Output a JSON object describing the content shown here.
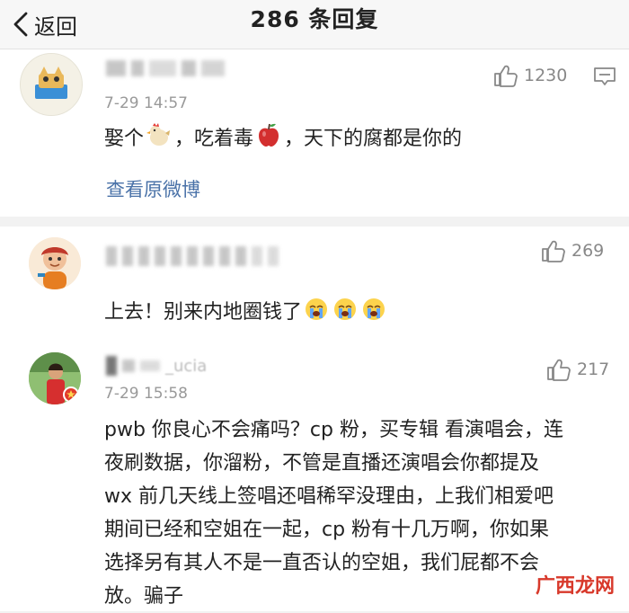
{
  "header": {
    "back_label": "返回",
    "title": "286 条回复"
  },
  "comments": [
    {
      "time": "7-29 14:57",
      "likes": "1230",
      "text_parts": [
        "娶个",
        "，吃着毒",
        "，天下的腐都是你的"
      ],
      "link": "查看原微博"
    },
    {
      "likes": "269",
      "text": "上去！别来内地圈钱了"
    },
    {
      "name_visible": "_ucia",
      "time": "7-29 15:58",
      "likes": "217",
      "lines": [
        "pwb 你良心不会痛吗？cp 粉，买专辑 看演唱会，连",
        "夜刷数据，你溜粉，不管是直播还演唱会你都提及",
        "wx 前几天线上签唱还唱稀罕没理由，上我们相爱吧",
        "期间已经和空姐在一起，cp 粉有十几万啊，你如果",
        "选择另有其人不是一直否认的空姐，我们屁都不会",
        "放。骗子"
      ]
    }
  ],
  "watermark": "广西龙网",
  "colors": {
    "link": "#4a72a8",
    "watermark": "#d8392b",
    "text": "#222222",
    "meta": "#999999"
  },
  "icons": [
    "chevron-left-icon",
    "thumbs-up-icon",
    "more-options-icon",
    "chicken-emoji",
    "apple-emoji",
    "crying-emoji"
  ]
}
